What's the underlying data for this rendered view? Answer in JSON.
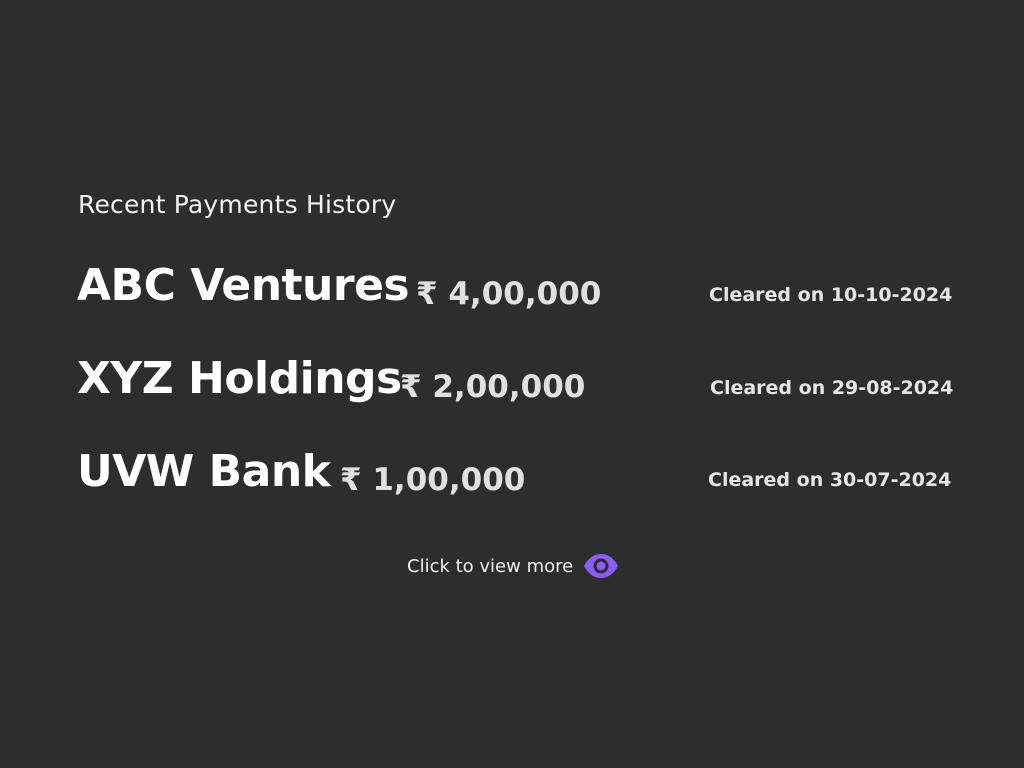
{
  "heading": "Recent Payments History",
  "payments": [
    {
      "company": "ABC Ventures",
      "amount": "₹ 4,00,000",
      "status": "Cleared on 10-10-2024"
    },
    {
      "company": "XYZ Holdings",
      "amount": "₹ 2,00,000",
      "status": "Cleared on 29-08-2024"
    },
    {
      "company": "UVW Bank",
      "amount": "₹ 1,00,000",
      "status": "Cleared on 30-07-2024"
    }
  ],
  "view_more": {
    "label": "Click to view more",
    "icon": "eye-icon",
    "icon_color": "#8b5cf6"
  },
  "colors": {
    "background": "#2d2d2d",
    "text": "#ffffff",
    "accent": "#8b5cf6"
  }
}
